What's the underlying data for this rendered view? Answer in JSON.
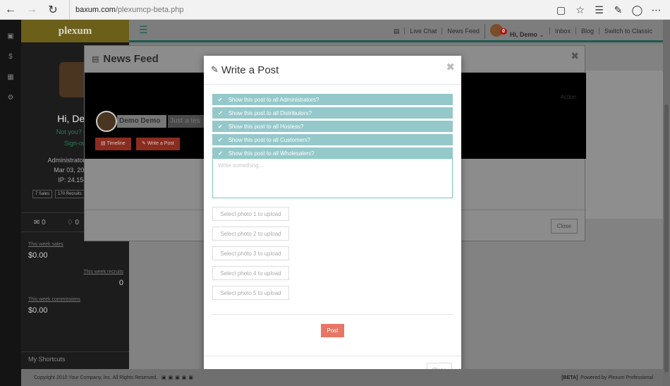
{
  "browser": {
    "url_host": "baxum.com",
    "url_path": "/plexumcp-beta.php"
  },
  "sidebar": {
    "logo": "plexum",
    "greeting": "Hi, Dem",
    "not_you": "Not you? Clic",
    "sign_out": "Sign-ou",
    "admin_since": "Administrator Since",
    "date": "Mar 03, 2016 0",
    "ip": "IP: 24.155.2",
    "stat_sales": "7 Sales",
    "stat_recruits": "170 Recruits",
    "msg_count": "0",
    "alert_count": "0",
    "week_sales_label": "This week sales",
    "week_sales_value": "$0.00",
    "week_recruits_label": "This week recruits",
    "week_recruits_value": "0",
    "week_comm_label": "This week commissions",
    "week_comm_value": "$0.00",
    "shortcuts": "My Shortcuts"
  },
  "topbar": {
    "live_chat": "Live Chat",
    "news_feed": "News Feed",
    "badge": "0",
    "user": "Hi, Demo",
    "inbox": "Inbox",
    "blog": "Blog",
    "switch": "Switch to Classic"
  },
  "newsfeed": {
    "title": "News Feed",
    "name": "Demo Demo",
    "status_placeholder": "Just a tes",
    "timeline_btn": "Timeline",
    "write_btn": "Write a Post",
    "close": "Close",
    "action": "Action"
  },
  "modal": {
    "title": "Write a Post",
    "checks": [
      "Show this post to all Administrators?",
      "Show this post to all Distributors?",
      "Show this post to all Hostess?",
      "Show this post to all Customers?",
      "Show this post to all Wholesalers?"
    ],
    "placeholder": "Write something...",
    "photos": [
      "Select photo 1 to upload",
      "Select photo 2 to upload",
      "Select photo 3 to upload",
      "Select photo 4 to upload",
      "Select photo 5 to upload"
    ],
    "post": "Post",
    "close": "Close"
  },
  "footer": {
    "copyright": "Copyright 2010 Your Company, Inc. All Rights Reserved.",
    "beta": "[BETA]",
    "powered": "Powered by Plexum Professional"
  },
  "colors": {
    "check_bg": "#95c8ca",
    "post_btn": "#e87565",
    "textarea_border": "#7ccab0"
  }
}
